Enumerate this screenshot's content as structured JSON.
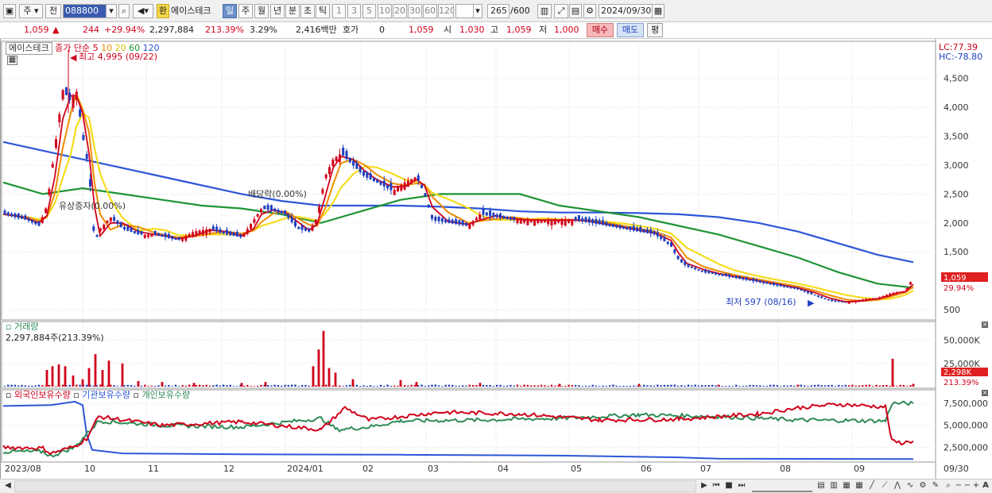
{
  "toolbar": {
    "market": "주",
    "prev_label": "전",
    "code": "088800",
    "hwan": "환",
    "stock_name": "에이스테크",
    "periods": [
      "일",
      "주",
      "월",
      "년",
      "분",
      "초",
      "틱"
    ],
    "active_period": "일",
    "intervals": [
      "1",
      "3",
      "5",
      "10",
      "20",
      "30",
      "60",
      "120"
    ],
    "count": "265",
    "count_max": "/600",
    "date": "2024/09/30"
  },
  "quote": {
    "price": "1,059",
    "change": "244",
    "change_pct": "+29.94%",
    "volume": "2,297,884",
    "volume_ratio": "213.39%",
    "turnover": "3.29%",
    "amount": "2,416백만",
    "hoga_label": "호가",
    "hoga_value": "0",
    "hoga_price": "1,059",
    "open_label": "시",
    "open": "1,030",
    "high_label": "고",
    "high": "1,059",
    "low_label": "저",
    "low": "1,000",
    "buy_label": "매수",
    "sell_label": "매도",
    "pyeong_label": "평"
  },
  "price_panel": {
    "name_box": "에이스테크",
    "ma_legend_title": "종가 단순",
    "ma_periods": [
      "5",
      "10",
      "20",
      "60",
      "120"
    ],
    "ma_colors": [
      "#d0021b",
      "#f08c00",
      "#f5dd1e",
      "#1e9436",
      "#2d56d8"
    ],
    "max_label": "최고 4,995 (09/22)",
    "min_label": "최저 597 (08/16)",
    "annotation_1": "유상증자(0.00%)",
    "annotation_2": "배당락(0.00%)",
    "lc": "LC:77.39",
    "hc": "HC:-78.80",
    "y_ticks": [
      "4,500",
      "4,000",
      "3,500",
      "3,000",
      "2,500",
      "2,000",
      "1,500",
      "500"
    ],
    "current_price_tag": "1,059",
    "current_pct_tag": "29.94%"
  },
  "volume_panel": {
    "title": "거래량",
    "value": "2,297,884주(213.39%)",
    "y_ticks": [
      "50,000K",
      "25,000K"
    ],
    "current_tag": "2,298K",
    "current_pct": "213.39%"
  },
  "holding_panel": {
    "series": [
      "외국인보유수량",
      "기관보유수량",
      "개인보유수량"
    ],
    "colors": [
      "#d0021b",
      "#2d56d8",
      "#2e8b57"
    ],
    "y_ticks": [
      "7,500,000",
      "5,000,000",
      "2,500,000"
    ]
  },
  "x_axis": {
    "labels": [
      "2023/08",
      "10",
      "11",
      "12",
      "2024/01",
      "02",
      "03",
      "04",
      "05",
      "06",
      "07",
      "08",
      "09",
      "09/30"
    ]
  },
  "chart_data": {
    "type": "line",
    "price_y_range": [
      350,
      5100
    ],
    "price_close_path": [
      [
        0,
        2150
      ],
      [
        15,
        2100
      ],
      [
        30,
        2050
      ],
      [
        45,
        1950
      ],
      [
        55,
        2300
      ],
      [
        65,
        3300
      ],
      [
        75,
        4300
      ],
      [
        85,
        4100
      ],
      [
        92,
        4300
      ],
      [
        100,
        3500
      ],
      [
        108,
        2900
      ],
      [
        115,
        1650
      ],
      [
        122,
        1900
      ],
      [
        135,
        2100
      ],
      [
        150,
        1900
      ],
      [
        170,
        1800
      ],
      [
        190,
        1800
      ],
      [
        205,
        1750
      ],
      [
        220,
        1700
      ],
      [
        240,
        1850
      ],
      [
        260,
        1900
      ],
      [
        280,
        1800
      ],
      [
        300,
        1750
      ],
      [
        315,
        2050
      ],
      [
        325,
        2250
      ],
      [
        340,
        2200
      ],
      [
        355,
        2150
      ],
      [
        370,
        1900
      ],
      [
        385,
        1850
      ],
      [
        395,
        2100
      ],
      [
        405,
        2800
      ],
      [
        415,
        3100
      ],
      [
        425,
        3200
      ],
      [
        440,
        3000
      ],
      [
        455,
        2800
      ],
      [
        470,
        2700
      ],
      [
        490,
        2550
      ],
      [
        505,
        2700
      ],
      [
        520,
        2800
      ],
      [
        530,
        2500
      ],
      [
        540,
        2050
      ],
      [
        560,
        2000
      ],
      [
        585,
        1950
      ],
      [
        600,
        2150
      ],
      [
        620,
        2100
      ],
      [
        640,
        2050
      ],
      [
        660,
        2050
      ],
      [
        680,
        2050
      ],
      [
        700,
        2050
      ],
      [
        720,
        2050
      ],
      [
        740,
        2000
      ],
      [
        760,
        1950
      ],
      [
        780,
        1900
      ],
      [
        800,
        1850
      ],
      [
        820,
        1800
      ],
      [
        840,
        1600
      ],
      [
        850,
        1350
      ],
      [
        860,
        1250
      ],
      [
        880,
        1150
      ],
      [
        900,
        1100
      ],
      [
        920,
        1050
      ],
      [
        940,
        1000
      ],
      [
        960,
        950
      ],
      [
        980,
        900
      ],
      [
        1000,
        850
      ],
      [
        1020,
        750
      ],
      [
        1040,
        650
      ],
      [
        1060,
        620
      ],
      [
        1080,
        680
      ],
      [
        1100,
        700
      ],
      [
        1115,
        780
      ],
      [
        1125,
        800
      ],
      [
        1135,
        820
      ],
      [
        1145,
        1059
      ]
    ],
    "ma120_path": [
      [
        0,
        3400
      ],
      [
        50,
        3250
      ],
      [
        100,
        3100
      ],
      [
        150,
        2950
      ],
      [
        200,
        2800
      ],
      [
        250,
        2650
      ],
      [
        300,
        2500
      ],
      [
        350,
        2380
      ],
      [
        400,
        2300
      ],
      [
        450,
        2300
      ],
      [
        500,
        2300
      ],
      [
        550,
        2280
      ],
      [
        600,
        2250
      ],
      [
        650,
        2200
      ],
      [
        700,
        2180
      ],
      [
        750,
        2180
      ],
      [
        800,
        2170
      ],
      [
        850,
        2150
      ],
      [
        900,
        2100
      ],
      [
        950,
        2000
      ],
      [
        1000,
        1850
      ],
      [
        1050,
        1650
      ],
      [
        1100,
        1450
      ],
      [
        1145,
        1320
      ]
    ],
    "ma60_path": [
      [
        0,
        2700
      ],
      [
        50,
        2500
      ],
      [
        100,
        2600
      ],
      [
        150,
        2500
      ],
      [
        200,
        2400
      ],
      [
        250,
        2300
      ],
      [
        300,
        2250
      ],
      [
        350,
        2150
      ],
      [
        400,
        2000
      ],
      [
        450,
        2200
      ],
      [
        500,
        2400
      ],
      [
        550,
        2500
      ],
      [
        600,
        2500
      ],
      [
        650,
        2500
      ],
      [
        700,
        2300
      ],
      [
        750,
        2200
      ],
      [
        800,
        2100
      ],
      [
        850,
        1950
      ],
      [
        900,
        1800
      ],
      [
        950,
        1600
      ],
      [
        1000,
        1400
      ],
      [
        1050,
        1150
      ],
      [
        1100,
        950
      ],
      [
        1145,
        880
      ]
    ],
    "volume_bars_k": [
      [
        55,
        18
      ],
      [
        62,
        22
      ],
      [
        70,
        24
      ],
      [
        78,
        22
      ],
      [
        88,
        12
      ],
      [
        100,
        8
      ],
      [
        108,
        20
      ],
      [
        116,
        35
      ],
      [
        125,
        18
      ],
      [
        133,
        28
      ],
      [
        150,
        25
      ],
      [
        170,
        6
      ],
      [
        200,
        5
      ],
      [
        240,
        4
      ],
      [
        300,
        4
      ],
      [
        330,
        5
      ],
      [
        390,
        22
      ],
      [
        397,
        40
      ],
      [
        403,
        60
      ],
      [
        410,
        20
      ],
      [
        418,
        15
      ],
      [
        440,
        8
      ],
      [
        500,
        7
      ],
      [
        520,
        5
      ],
      [
        600,
        4
      ],
      [
        700,
        3
      ],
      [
        800,
        3
      ],
      [
        900,
        2
      ],
      [
        1000,
        2
      ],
      [
        1119,
        30
      ],
      [
        1145,
        3
      ]
    ]
  }
}
